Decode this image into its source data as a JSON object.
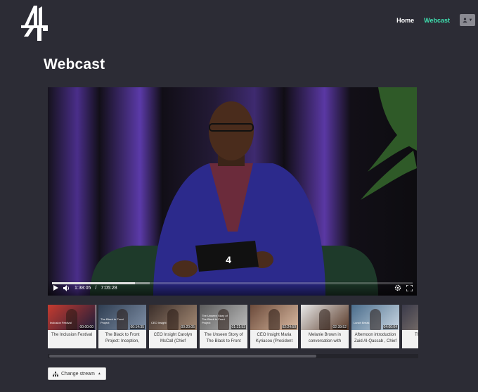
{
  "nav": {
    "home": "Home",
    "webcast": "Webcast"
  },
  "page": {
    "title": "Webcast"
  },
  "player": {
    "current_time": "1:38:05",
    "separator": "/",
    "duration": "7:05:28",
    "progress_fraction": 0.23,
    "buffer_fraction": 0.27,
    "slate_brand": "4"
  },
  "thumbnails": [
    {
      "title": "The Inclusion Festival",
      "duration": "00:00:00",
      "img_caption": "Inclusion Festival",
      "selected": true
    },
    {
      "title": "The Black to Front Project: Inception,",
      "duration": "00:14:35",
      "img_caption": "The Black to Front Project",
      "selected": false
    },
    {
      "title": "CEO Insight Carolyn McCall (Chief",
      "duration": "00:20:05",
      "img_caption": "CEO Insight",
      "selected": false
    },
    {
      "title": "The Unseen Story of The Black to Front",
      "duration": "01:31:53",
      "img_caption": "The Unseen Story of The Black to Front Project",
      "selected": false
    },
    {
      "title": "CEO Insight Maria Kyriacou (President",
      "duration": "02:24:50",
      "img_caption": "",
      "selected": false
    },
    {
      "title": "Melanie Brown in conversation with",
      "duration": "02:39:52",
      "img_caption": "",
      "selected": false
    },
    {
      "title": "Afternoon introduction Zaid Al-Qassab , Chief",
      "duration": "04:00:04",
      "img_caption": "Lunch Break",
      "selected": false
    },
    {
      "title": "The D Have",
      "duration": "",
      "img_caption": "",
      "selected": false
    }
  ],
  "stream": {
    "label": "Change stream"
  },
  "colors": {
    "background": "#2c2c35",
    "accent": "#3fe0b0",
    "user_button": "#8a8a92"
  },
  "icons": {
    "logo": "channel-4-logo",
    "user": "user-icon",
    "play": "play-icon",
    "volume": "volume-icon",
    "settings": "settings-icon",
    "fullscreen": "fullscreen-icon",
    "stream": "sitemap-icon"
  }
}
